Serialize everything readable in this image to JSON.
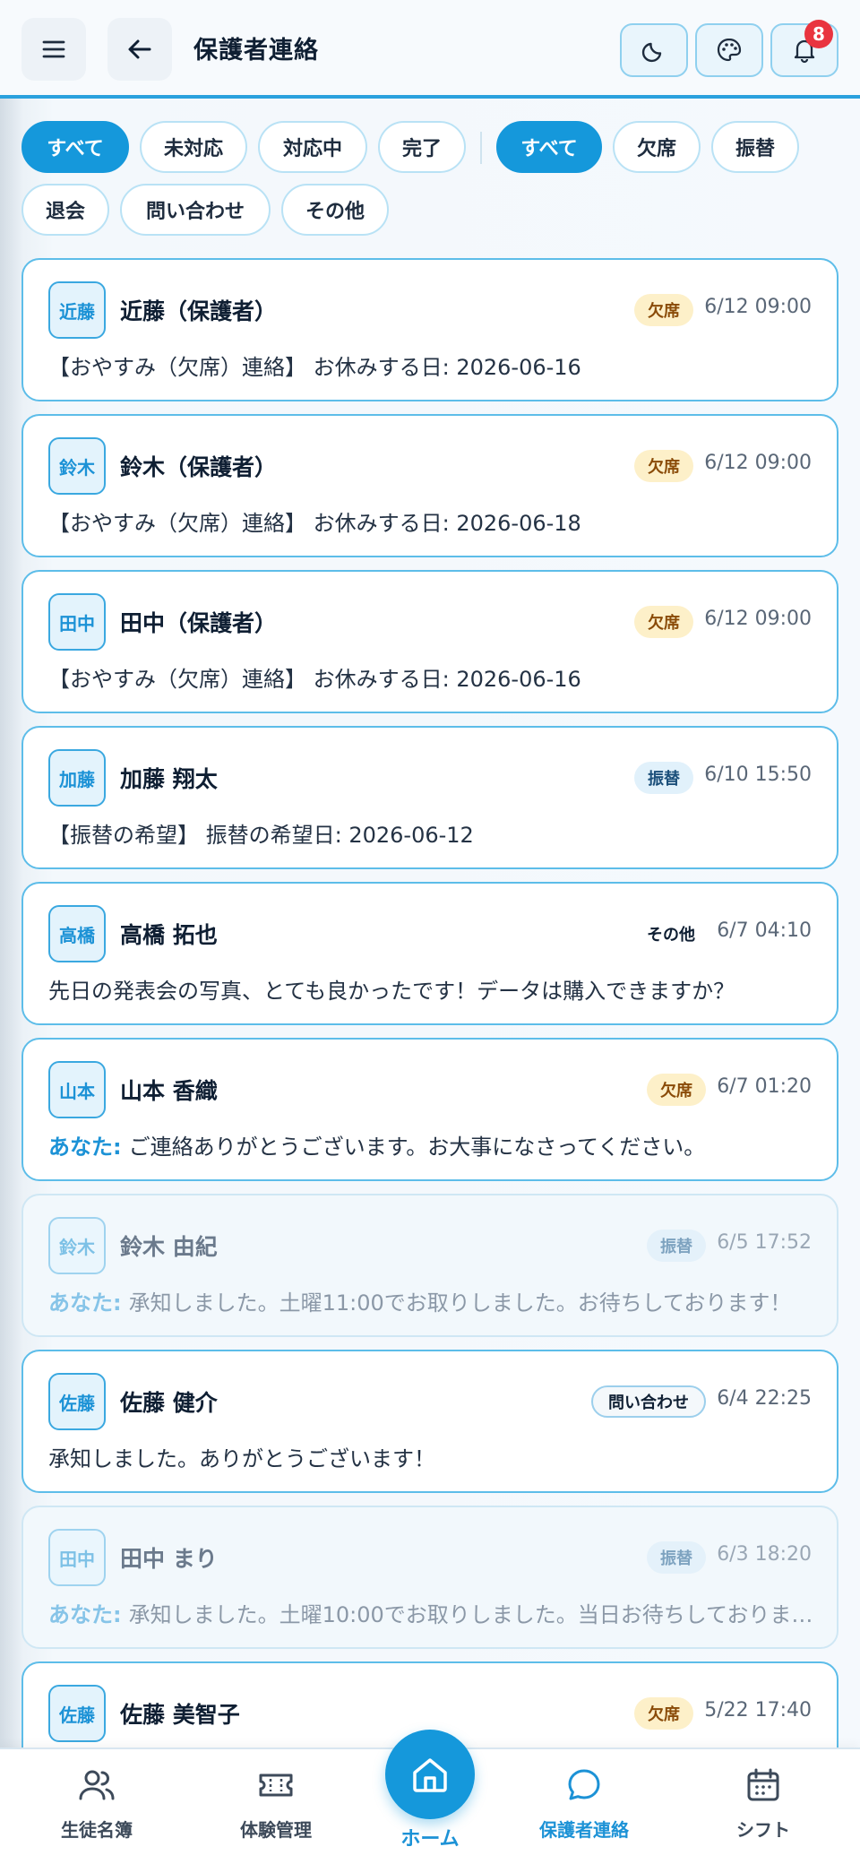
{
  "header": {
    "title": "保護者連絡",
    "notification_count": "8",
    "icons": [
      "menu-icon",
      "back-arrow-icon",
      "moon-icon",
      "palette-icon",
      "bell-icon"
    ]
  },
  "filters": {
    "status": [
      "すべて",
      "未対応",
      "対応中",
      "完了"
    ],
    "category": [
      "すべて",
      "欠席",
      "振替",
      "退会",
      "問い合わせ",
      "その他"
    ],
    "active_status": "すべて",
    "active_category": "すべて"
  },
  "you_label": "あなた:",
  "messages": [
    {
      "avatar": "近藤",
      "name": "近藤（保護者）",
      "tag": "欠席",
      "time": "6/12 09:00",
      "message": "【おやすみ（欠席）連絡】 お休みする日: 2026-06-16",
      "dim": false
    },
    {
      "avatar": "鈴木",
      "name": "鈴木（保護者）",
      "tag": "欠席",
      "time": "6/12 09:00",
      "message": "【おやすみ（欠席）連絡】 お休みする日: 2026-06-18",
      "dim": false
    },
    {
      "avatar": "田中",
      "name": "田中（保護者）",
      "tag": "欠席",
      "time": "6/12 09:00",
      "message": "【おやすみ（欠席）連絡】 お休みする日: 2026-06-16",
      "dim": false
    },
    {
      "avatar": "加藤",
      "name": "加藤 翔太",
      "tag": "振替",
      "time": "6/10 15:50",
      "message": "【振替の希望】 振替の希望日: 2026-06-12",
      "dim": false
    },
    {
      "avatar": "高橋",
      "name": "高橋 拓也",
      "tag": "その他",
      "time": "6/7 04:10",
      "message": "先日の発表会の写真、とても良かったです！データは購入できますか？",
      "dim": false
    },
    {
      "avatar": "山本",
      "name": "山本 香織",
      "tag": "欠席",
      "time": "6/7 01:20",
      "message": "ご連絡ありがとうございます。お大事になさってください。",
      "dim": false
    },
    {
      "avatar": "鈴木",
      "name": "鈴木 由紀",
      "tag": "振替",
      "time": "6/5 17:52",
      "message": "承知しました。土曜11:00でお取りしました。お待ちしております！",
      "dim": true
    },
    {
      "avatar": "佐藤",
      "name": "佐藤 健介",
      "tag": "問い合わせ",
      "time": "6/4 22:25",
      "message": "承知しました。ありがとうございます！",
      "dim": false
    },
    {
      "avatar": "田中",
      "name": "田中 まり",
      "tag": "振替",
      "time": "6/3 18:20",
      "message": "承知しました。土曜10:00でお取りしました。当日お待ちしておりま…",
      "dim": true
    },
    {
      "avatar": "佐藤",
      "name": "佐藤 美智子",
      "tag": "欠席",
      "time": "5/22 17:40",
      "message": "",
      "dim": false
    }
  ],
  "bottom_nav": {
    "items": [
      {
        "label": "生徒名簿",
        "icon": "users-icon"
      },
      {
        "label": "体験管理",
        "icon": "ticket-icon"
      },
      {
        "label": "ホーム",
        "icon": "home-icon"
      },
      {
        "label": "保護者連絡",
        "icon": "chat-bubble-icon"
      },
      {
        "label": "シフト",
        "icon": "calendar-icon"
      }
    ],
    "active": "保護者連絡"
  }
}
